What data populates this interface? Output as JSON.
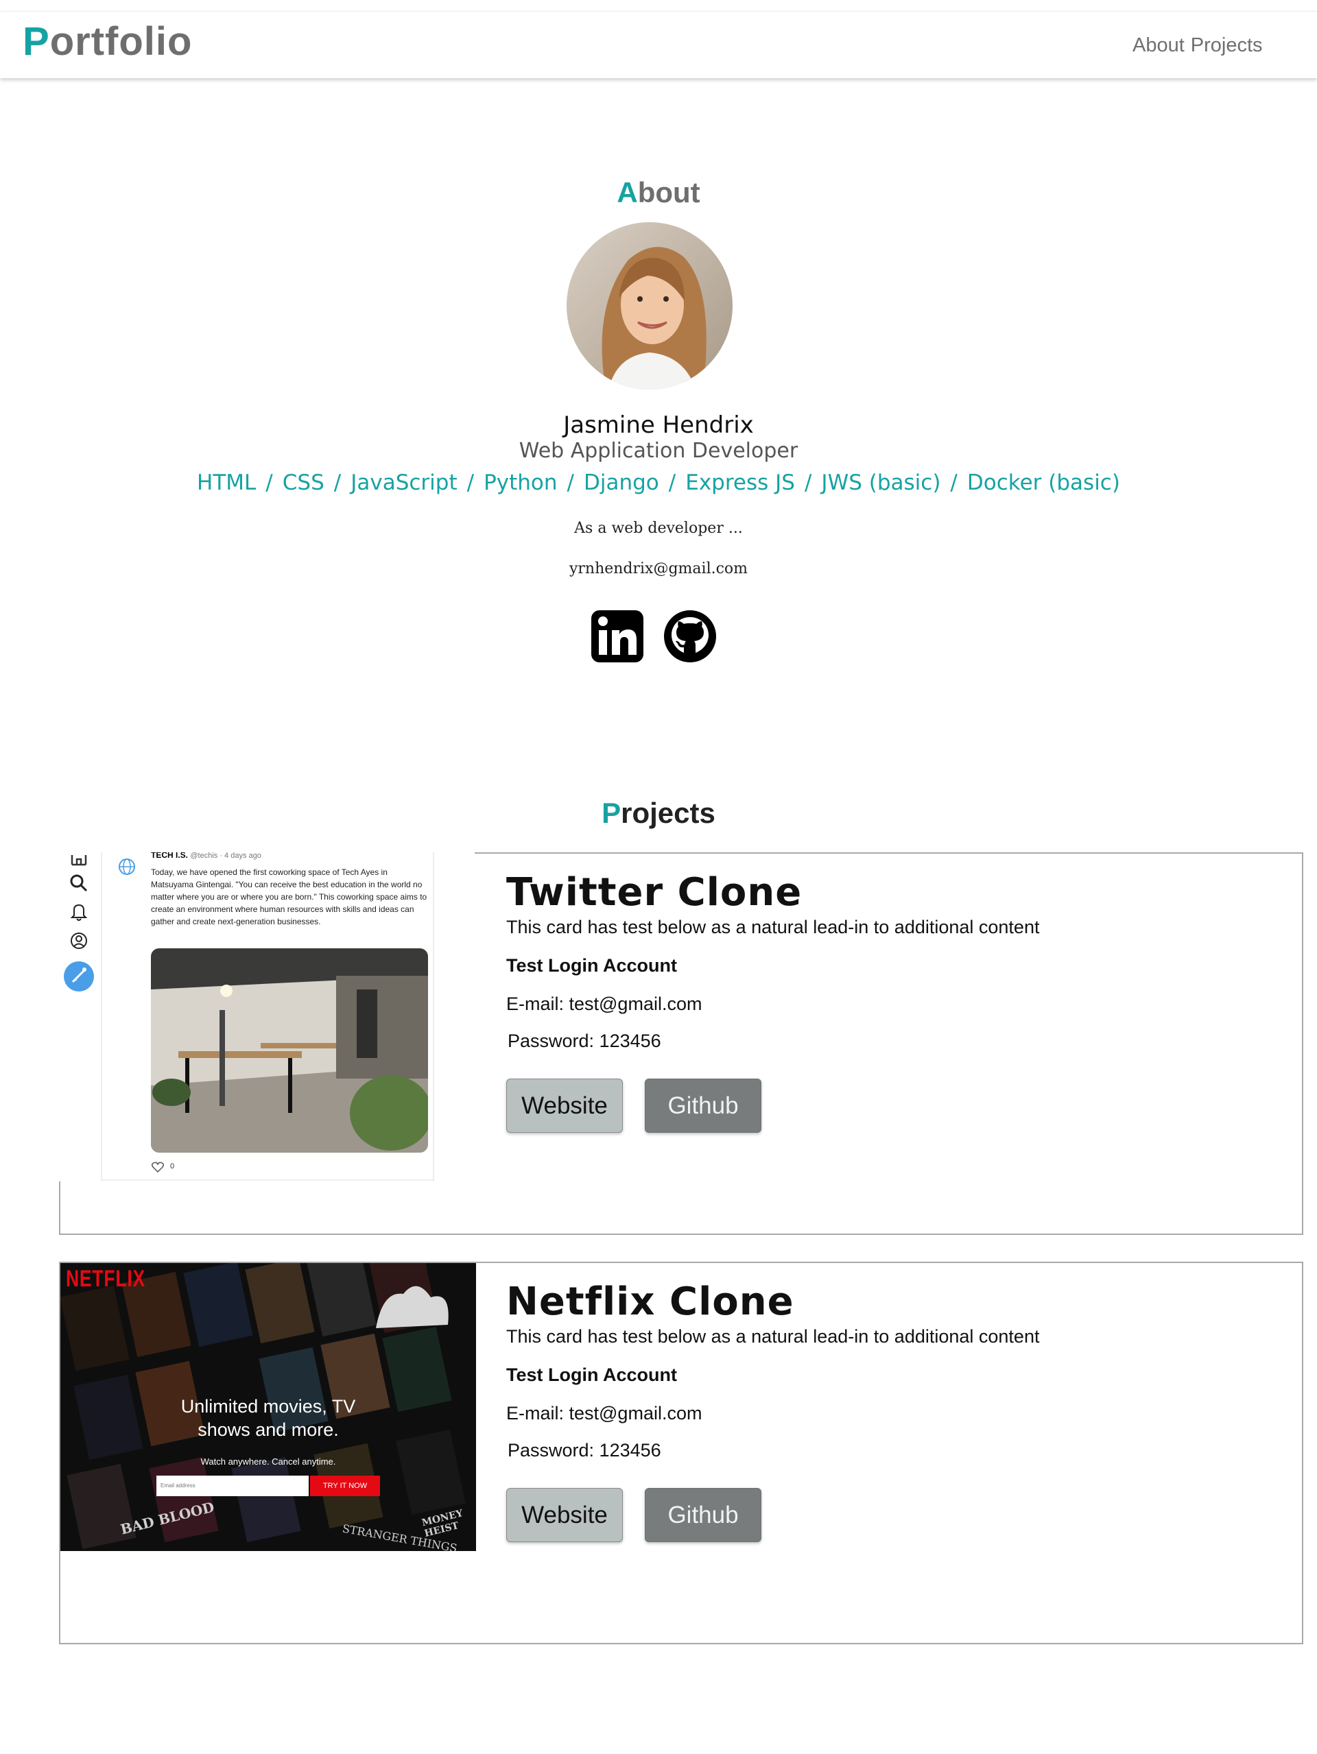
{
  "nav": {
    "brand_first": "P",
    "brand_rest": "ortfolio",
    "links": [
      "About",
      "Projects"
    ]
  },
  "about": {
    "title_first": "A",
    "title_rest": "bout",
    "name": "Jasmine Hendrix",
    "role": "Web Application Developer",
    "skills": [
      "HTML",
      "CSS",
      "JavaScript",
      "Python",
      "Django",
      "Express JS",
      "JWS (basic)",
      "Docker (basic)"
    ],
    "skill_separator": "/",
    "blurb": "As a web developer ...",
    "email": "yrnhendrix@gmail.com",
    "social_icons": [
      "linkedin-icon",
      "github-icon"
    ]
  },
  "projects": {
    "title_first": "P",
    "title_rest": "rojects",
    "cards": [
      {
        "title": "Twitter Clone",
        "text": "This card has test below as a natural lead-in to additional content",
        "login_heading": "Test Login Account",
        "email_line": "E-mail: test@gmail.com",
        "password_line": "Password: 123456",
        "website_label": "Website",
        "github_label": "Github",
        "screenshot": {
          "author": "TECH I.S.",
          "handle": "@techis · 4 days ago",
          "tweet": "Today, we have opened the first coworking space of Tech Ayes in Matsuyama Gintengai. \"You can receive the best education in the world no matter where you are or where you are born.\" This coworking space aims to create an environment where human resources with skills and ideas can gather and create next-generation businesses.",
          "likes": "0"
        }
      },
      {
        "title": "Netflix Clone",
        "text": "This card has test below as a natural lead-in to additional content",
        "login_heading": "Test Login Account",
        "email_line": "E-mail: test@gmail.com",
        "password_line": "Password: 123456",
        "website_label": "Website",
        "github_label": "Github",
        "screenshot": {
          "logo": "NETFLIX",
          "headline": "Unlimited movies, TV shows and more.",
          "subline": "Watch anywhere. Cancel anytime.",
          "email_placeholder": "Email address",
          "cta": "TRY IT NOW",
          "posters": [
            "BAD BLOOD",
            "MONEY HEIST",
            "STRANGER THINGS"
          ]
        }
      }
    ]
  },
  "colors": {
    "accent": "#17a2a2",
    "brand_gray": "#6e6e6e",
    "netflix_red": "#e50914"
  }
}
